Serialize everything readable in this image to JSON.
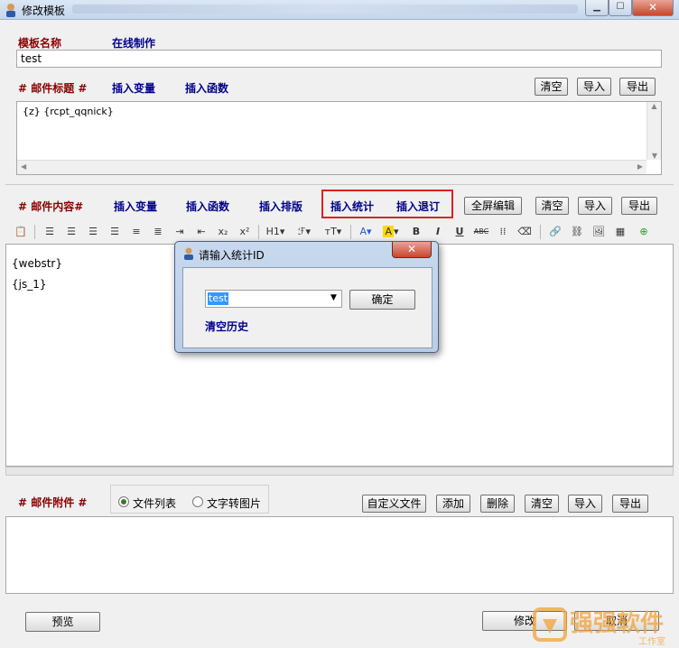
{
  "window": {
    "title": "修改模板"
  },
  "template_name": {
    "label": "模板名称",
    "online_label": "在线制作",
    "value": "test"
  },
  "subject": {
    "label": "# 邮件标题 #",
    "insert_var": "插入变量",
    "insert_func": "插入函数",
    "buttons": {
      "clear": "清空",
      "import": "导入",
      "export": "导出"
    },
    "value": "{z} {rcpt_qqnick}"
  },
  "content": {
    "label": "# 邮件内容#",
    "insert_var": "插入变量",
    "insert_func": "插入函数",
    "insert_layout": "插入排版",
    "insert_stats": "插入统计",
    "insert_unsub": "插入退订",
    "buttons": {
      "fullscreen": "全屏编辑",
      "clear": "清空",
      "import": "导入",
      "export": "导出"
    },
    "lines": [
      "{webstr}",
      "{js_1}"
    ],
    "toolbar": {
      "heading": "H1",
      "subscript": "x₂",
      "superscript": "x²",
      "bold": "B",
      "italic": "I",
      "underline": "U",
      "strike": "ABC",
      "font_color": "A",
      "highlight": "A"
    }
  },
  "attachments": {
    "label": "# 邮件附件 #",
    "radio_file_list": "文件列表",
    "radio_text_to_image": "文字转图片",
    "radio_selected": "文件列表",
    "buttons": {
      "custom_file": "自定义文件",
      "add": "添加",
      "delete": "删除",
      "clear": "清空",
      "import": "导入",
      "export": "导出"
    }
  },
  "footer": {
    "preview": "预览",
    "modify": "修改",
    "cancel": "取消"
  },
  "dialog": {
    "title": "请输入统计ID",
    "combo_value": "test",
    "confirm": "确定",
    "clear_history": "清空历史"
  },
  "watermark": {
    "text": "强强软件",
    "sub": "工作室"
  },
  "colors": {
    "label_red": "#8b0000",
    "label_blue": "#00008b",
    "highlight": "#e02020"
  }
}
